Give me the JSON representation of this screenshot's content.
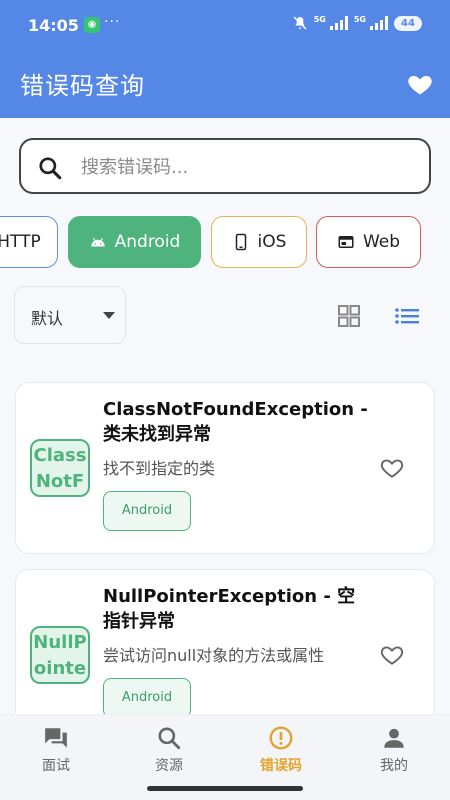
{
  "status": {
    "time": "14:05",
    "app_badge": "◉",
    "dots": "···",
    "net1": "5G",
    "net2": "5G",
    "battery": "44"
  },
  "appbar": {
    "title": "错误码查询",
    "favorite_icon": "heart-icon"
  },
  "search": {
    "placeholder": "搜索错误码...",
    "value": ""
  },
  "chips": [
    {
      "label": "HTTP",
      "icon": "globe-icon"
    },
    {
      "label": "Android",
      "icon": "android-icon",
      "selected": true
    },
    {
      "label": "iOS",
      "icon": "phone-icon"
    },
    {
      "label": "Web",
      "icon": "browser-icon"
    }
  ],
  "sort": {
    "selected": "默认"
  },
  "view": {
    "grid_icon": "grid-view-icon",
    "list_icon": "list-view-icon",
    "active": "list"
  },
  "items": [
    {
      "thumb": "ClassNotF",
      "thumb_line1": "Class",
      "thumb_line2": "NotF",
      "title": "ClassNotFoundException - 类未找到异常",
      "description": "找不到指定的类",
      "tag": "Android"
    },
    {
      "thumb": "NullPointe",
      "thumb_line1": "NullP",
      "thumb_line2": "ointe",
      "title": "NullPointerException - 空指针异常",
      "description": "尝试访问null对象的方法或属性",
      "tag": "Android"
    }
  ],
  "nav": [
    {
      "label": "面试",
      "icon": "chat-icon"
    },
    {
      "label": "资源",
      "icon": "search-icon"
    },
    {
      "label": "错误码",
      "icon": "alert-circle-icon",
      "active": true
    },
    {
      "label": "我的",
      "icon": "person-icon"
    }
  ],
  "colors": {
    "primary": "#5588e6",
    "android": "#4fb37e",
    "ios": "#e6b44c",
    "web": "#d45a5a",
    "active_nav": "#e3a42c"
  }
}
